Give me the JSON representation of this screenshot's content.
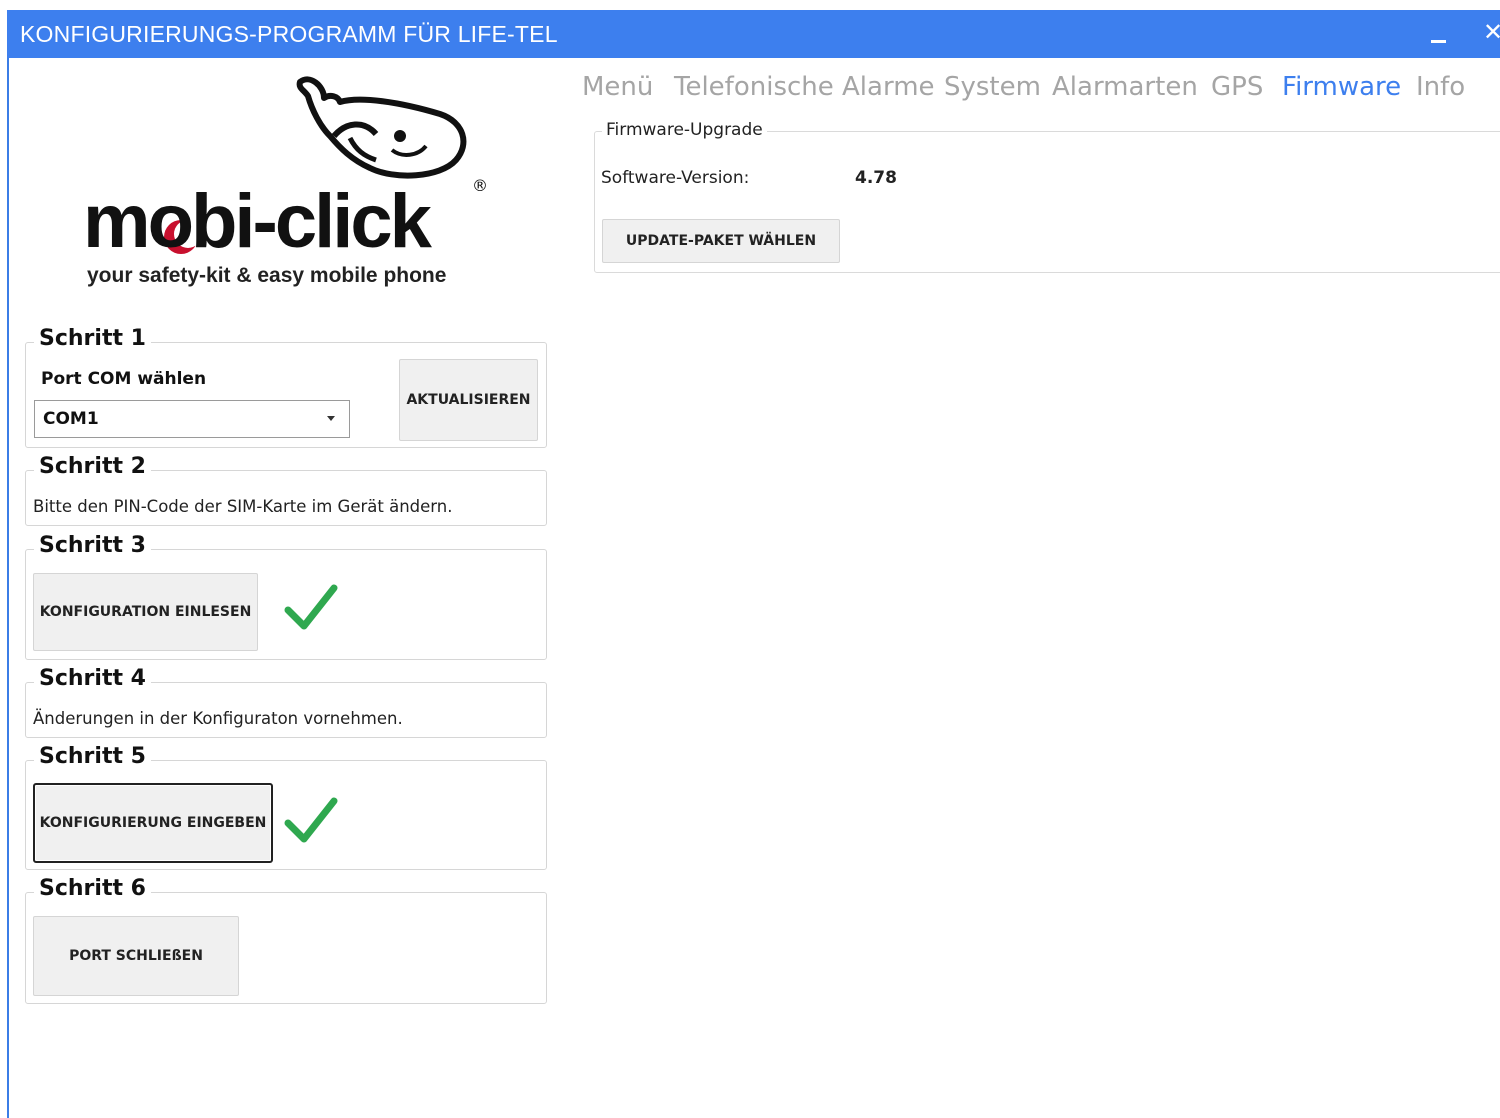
{
  "window": {
    "title": "KONFIGURIERUNGS-PROGRAMM FÜR LIFE-TEL",
    "close_glyph": "✕"
  },
  "logo": {
    "wordmark": "mobi-click",
    "registered": "®",
    "tagline": "your safety-kit & easy mobile phone"
  },
  "steps": {
    "s1": {
      "title": "Schritt 1",
      "port_label": "Port COM wählen",
      "port_value": "COM1",
      "refresh_label": "AKTUALISIEREN"
    },
    "s2": {
      "title": "Schritt 2",
      "text": "Bitte den PIN-Code der SIM-Karte im Gerät ändern."
    },
    "s3": {
      "title": "Schritt 3",
      "button": "KONFIGURATION EINLESEN",
      "status": "check-icon"
    },
    "s4": {
      "title": "Schritt 4",
      "text": "Änderungen in der Konfiguraton vornehmen."
    },
    "s5": {
      "title": "Schritt 5",
      "button": "KONFIGURIERUNG EINGEBEN",
      "status": "check-icon"
    },
    "s6": {
      "title": "Schritt 6",
      "button": "PORT SCHLIEßEN"
    }
  },
  "tabs": [
    "Menü",
    "Telefonische Alarme",
    "System",
    "Alarmarten",
    "GPS",
    "Firmware",
    "Info"
  ],
  "active_tab": "Firmware",
  "firmware": {
    "group_title": "Firmware-Upgrade",
    "version_label": "Software-Version:",
    "version_value": "4.78",
    "update_button": "UPDATE-PAKET WÄHLEN"
  },
  "colors": {
    "accent": "#3d7fee",
    "check": "#2fa84f",
    "moon": "#c8102e"
  }
}
